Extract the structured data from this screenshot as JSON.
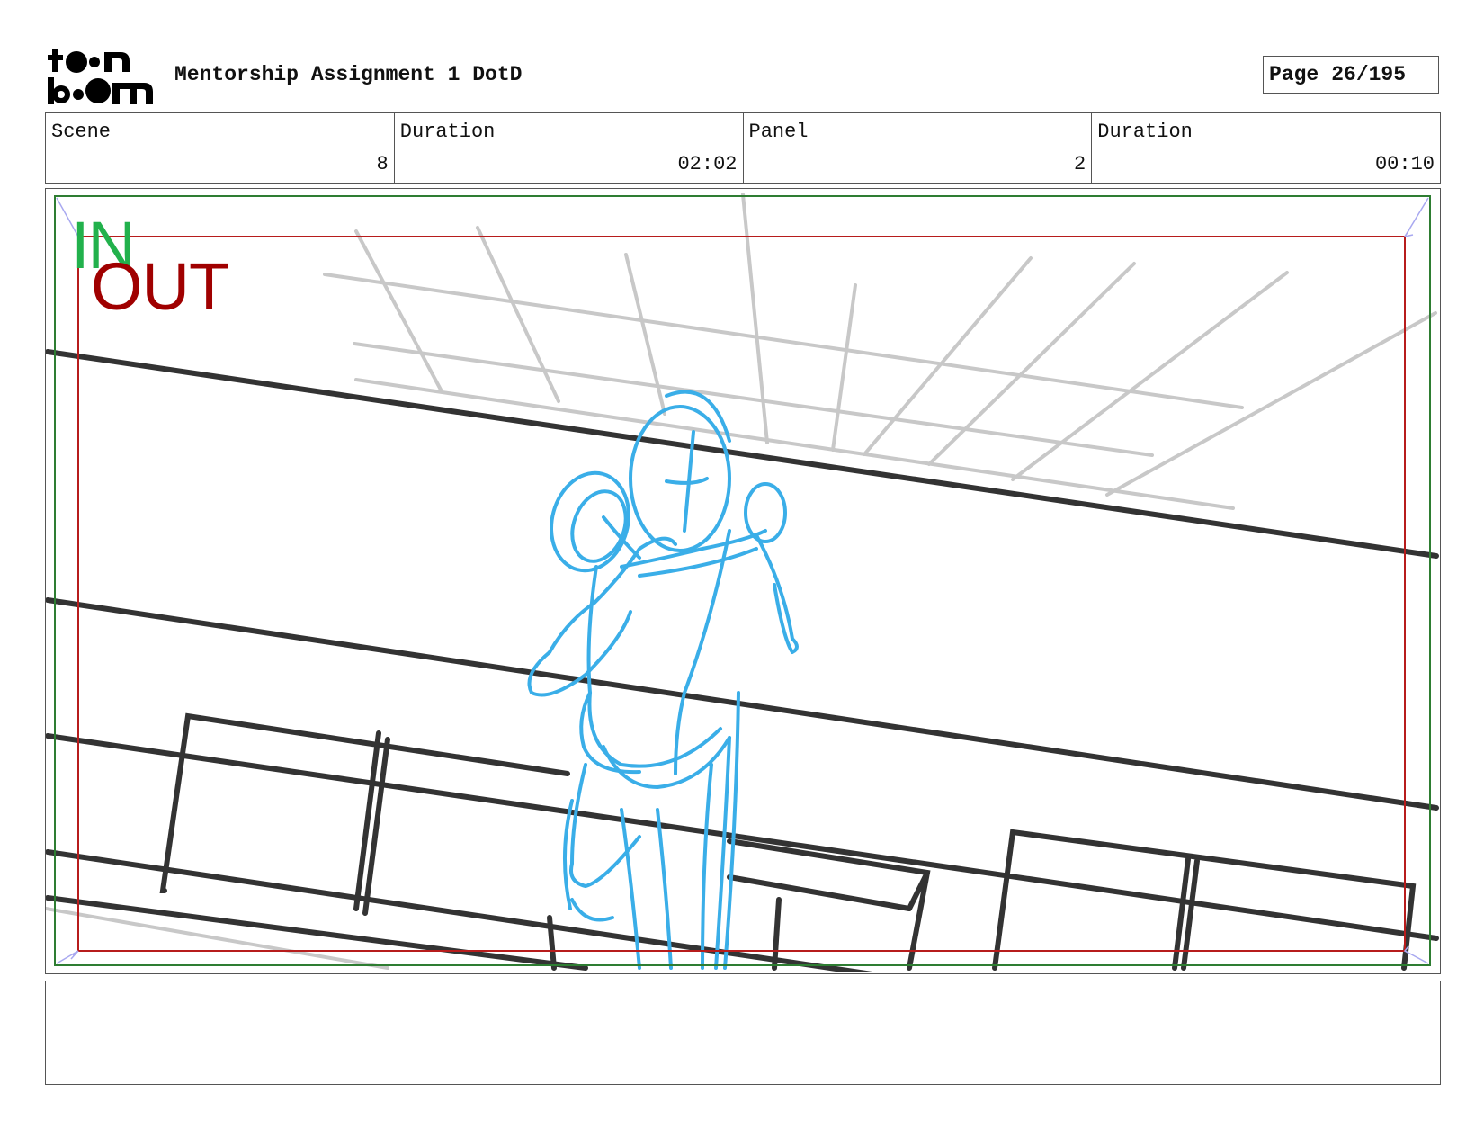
{
  "header": {
    "logo_text": "toon boom",
    "title": "Mentorship Assignment 1 DotD",
    "page_label": "Page",
    "page_number": "26/195"
  },
  "info": {
    "scene_label": "Scene",
    "scene_value": "8",
    "scene_duration_label": "Duration",
    "scene_duration_value": "02:02",
    "panel_label": "Panel",
    "panel_value": "2",
    "panel_duration_label": "Duration",
    "panel_duration_value": "00:10"
  },
  "panel": {
    "in_label": "IN",
    "out_label": "OUT",
    "colors": {
      "in_frame": "#2e7d32",
      "out_frame": "#b71c1c",
      "sketch_character": "#3aaee8",
      "sketch_lines_dark": "#333333",
      "sketch_lines_light": "#c8c8c8"
    }
  },
  "notes": {
    "text": ""
  }
}
